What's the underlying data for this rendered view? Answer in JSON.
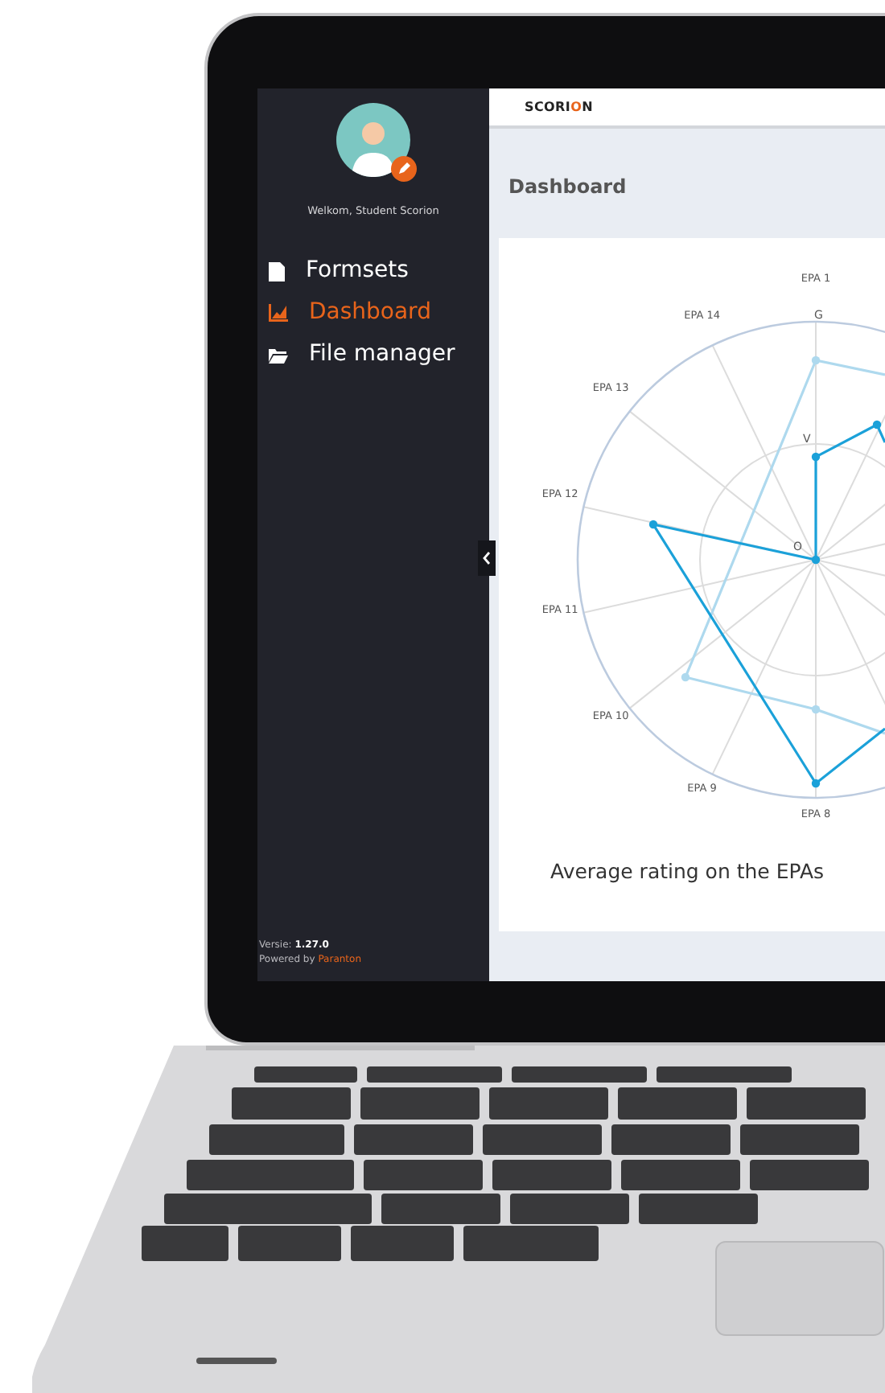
{
  "sidebar": {
    "greeting": "Welkom, Student Scorion",
    "nav_items": [
      {
        "label": "Formsets",
        "kind": "document",
        "selected": false
      },
      {
        "label": "Dashboard",
        "kind": "chart",
        "selected": true
      },
      {
        "label": "File manager",
        "kind": "folder",
        "selected": false
      }
    ],
    "version": "Versie: **1.27.0**",
    "powered_by": "Powered by",
    "powered_by_link": "Paranton"
  },
  "header": {
    "logo": [
      {
        "text": "SCORI",
        "accent": false
      },
      {
        "text": "O",
        "accent": true
      },
      {
        "text": "N",
        "accent": false
      }
    ]
  },
  "page_title": "Dashboard",
  "chart": {
    "title": "Average rating on the EPAs",
    "axis_labels": [
      "EPA 1",
      "EPA 14",
      "EPA 13",
      "EPA 12",
      "EPA 11",
      "EPA 10",
      "EPA 9",
      "EPA 8"
    ],
    "ring_labels": [
      "O",
      "V",
      "G"
    ]
  }
}
